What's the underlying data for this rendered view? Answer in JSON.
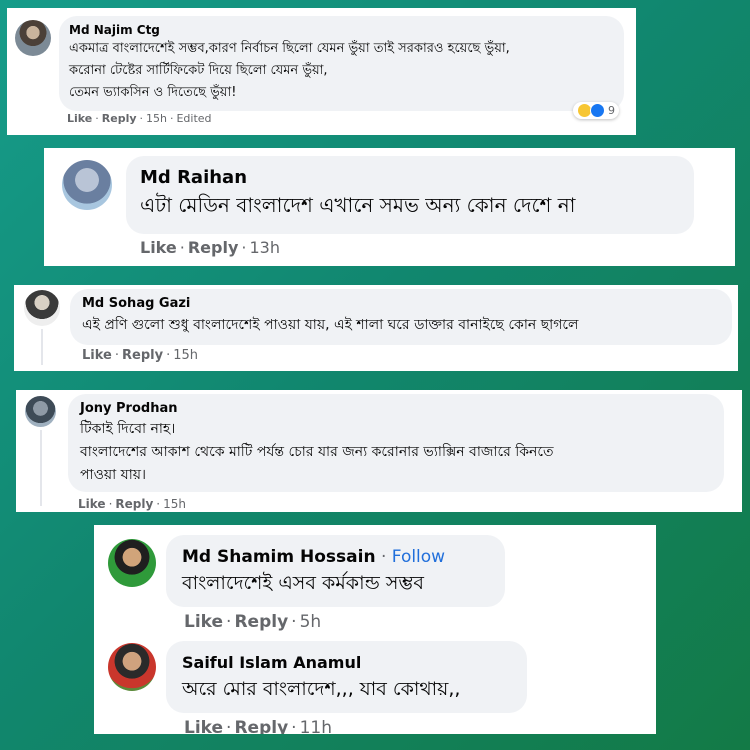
{
  "comments": [
    {
      "name": "Md Najim Ctg",
      "lines": [
        "একমাত্র বাংলাদেশেই সম্ভব,কারণ নির্বাচন ছিলো যেমন ভুঁয়া তাই সরকারও হয়েছে ভুঁয়া,",
        "করোনা টেষ্টের সার্টিফিকেট দিয়ে ছিলো যেমন ভুঁয়া,",
        "তেমন ভ্যাকসিন ও দিতেছে ভুঁয়া!"
      ],
      "like": "Like",
      "reply": "Reply",
      "time": "15h",
      "edited": "Edited",
      "reaction_icons": [
        "haha-icon",
        "like-icon"
      ],
      "reaction_count": "9"
    },
    {
      "name": "Md Raihan",
      "lines": [
        "এটা মেডিন বাংলাদেশ এখানে সমভ অন্য কোন দেশে না"
      ],
      "like": "Like",
      "reply": "Reply",
      "time": "13h"
    },
    {
      "name": "Md Sohag Gazi",
      "lines": [
        "এই প্রণি গুলো শুধু বাংলাদেশেই পাওয়া যায়, এই শালা ঘরে ডাক্তার বানাইছে কোন ছাগলে"
      ],
      "like": "Like",
      "reply": "Reply",
      "time": "15h"
    },
    {
      "name": "Jony Prodhan",
      "lines": [
        "টিকাই দিবো নাহ।",
        "বাংলাদেশের আকাশ থেকে মাটি পর্যন্ত চোর যার জন্য করোনার ভ্যাক্সিন বাজারে কিনতে",
        "পাওয়া যায়।"
      ],
      "like": "Like",
      "reply": "Reply",
      "time": "15h"
    },
    {
      "name": "Md Shamim Hossain",
      "follow": "Follow",
      "lines": [
        "বাংলাদেশেই এসব কর্মকান্ড সম্ভব"
      ],
      "like": "Like",
      "reply": "Reply",
      "time": "5h"
    },
    {
      "name": "Saiful Islam Anamul",
      "lines": [
        "অরে মোর বাংলাদেশ,,, যাব কোথায়,,"
      ],
      "like": "Like",
      "reply": "Reply",
      "time": "11h"
    }
  ],
  "colors": {
    "background_start": "#169c8a",
    "background_end": "#137a46",
    "bubble": "#f0f2f5",
    "meta_text": "#65676b",
    "follow_link": "#216fdb"
  }
}
